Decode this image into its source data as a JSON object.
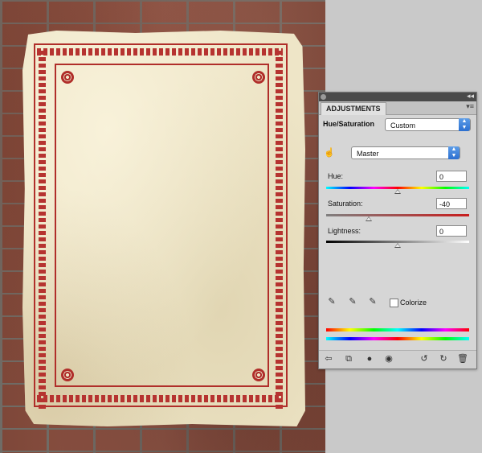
{
  "panel": {
    "tab_label": "ADJUSTMENTS",
    "adjustment_name": "Hue/Saturation",
    "preset_value": "Custom",
    "channel_value": "Master",
    "hue": {
      "label": "Hue:",
      "value": "0",
      "level": 0.5
    },
    "saturation": {
      "label": "Saturation:",
      "value": "-40",
      "level": 0.3
    },
    "lightness": {
      "label": "Lightness:",
      "value": "0",
      "level": 0.5
    },
    "colorize_label": "Colorize",
    "colorize_checked": false
  },
  "icons": {
    "target_adjust": "hand-target-icon",
    "eyedropper": "eyedropper-icon",
    "eyedropper_add": "eyedropper-plus-icon",
    "eyedropper_subtract": "eyedropper-minus-icon",
    "back": "back-arrow-icon",
    "expand": "expand-view-icon",
    "clip": "clip-to-layer-icon",
    "visibility": "eye-icon",
    "view_previous": "view-previous-icon",
    "reset": "reset-icon",
    "delete": "trash-icon"
  },
  "colors": {
    "frame_red": "#b02e2a",
    "paper": "#eee5c7",
    "brick": "#8c4f3f"
  }
}
